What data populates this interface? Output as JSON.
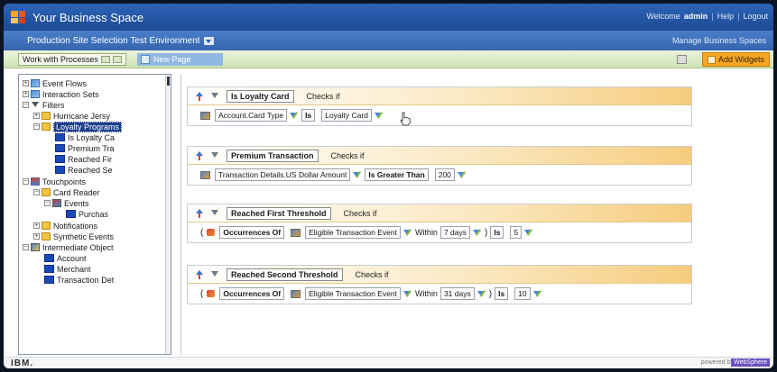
{
  "header": {
    "title": "Your Business Space",
    "welcome_prefix": "Welcome",
    "user": "admin",
    "separator": "|",
    "help": "Help",
    "logout": "Logout"
  },
  "space": {
    "name": "Production Site Selection Test Environment",
    "manage": "Manage Business Spaces"
  },
  "tabs": {
    "work_with": "Work with Processes",
    "page_name": "New Page",
    "add_widgets": "Add Widgets"
  },
  "tree": {
    "items": [
      {
        "label": "Event Flows"
      },
      {
        "label": "Interaction Sets"
      },
      {
        "label": "Filters"
      },
      {
        "label": "Hurricane Jersy"
      },
      {
        "label": "Loyalty Programs"
      },
      {
        "label": "Is Loyalty Ca"
      },
      {
        "label": "Premium Tra"
      },
      {
        "label": "Reached Fir"
      },
      {
        "label": "Reached Se"
      },
      {
        "label": "Touchpoints"
      },
      {
        "label": "Card Reader"
      },
      {
        "label": "Events"
      },
      {
        "label": "Purchas"
      },
      {
        "label": "Notifications"
      },
      {
        "label": "Synthetic Events"
      },
      {
        "label": "Intermediate Object"
      },
      {
        "label": "Account"
      },
      {
        "label": "Merchant"
      },
      {
        "label": "Transaction Det"
      }
    ]
  },
  "filters": [
    {
      "name": "Is Loyalty Card",
      "checks": "Checks if",
      "field": "Account.Card Type",
      "op": "Is",
      "value": "Loyalty Card"
    },
    {
      "name": "Premium Transaction",
      "checks": "Checks if",
      "field": "Transaction Details.US Dollar Amount",
      "op": "Is Greater Than",
      "value": "200"
    },
    {
      "name": "Reached First Threshold",
      "checks": "Checks if",
      "open_paren": "(",
      "func": "Occurrences Of",
      "field": "Eligible Transaction Event",
      "within": "Within",
      "period": "7 days",
      "close_paren": ")",
      "op": "Is",
      "value": "5"
    },
    {
      "name": "Reached Second Threshold",
      "checks": "Checks if",
      "open_paren": "(",
      "func": "Occurrences Of",
      "field": "Eligible Transaction Event",
      "within": "Within",
      "period": "31 days",
      "close_paren": ")",
      "op": "Is",
      "value": "10"
    }
  ],
  "footer": {
    "ibm": "IBM.",
    "powered": "powered by",
    "brand": "WebSphere"
  },
  "colors": {
    "title_bar": "#1c4a93",
    "space_bar": "#3565ae",
    "tab_bar": "#cfe2b4",
    "accent_orange": "#f5a623",
    "tree_selection": "#1c3f8c"
  }
}
